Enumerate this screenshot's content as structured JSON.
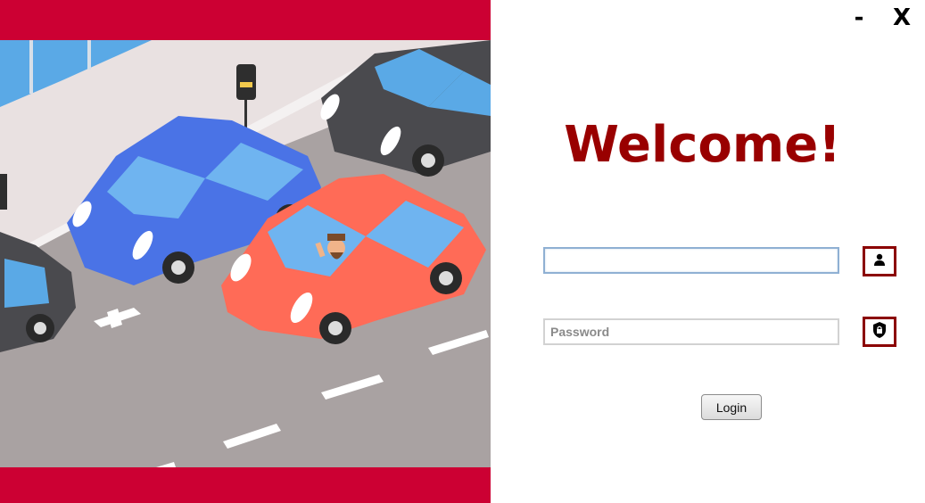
{
  "window": {
    "minimize_label": "-",
    "close_label": "X"
  },
  "login": {
    "heading": "Welcome!",
    "username": {
      "value": "",
      "placeholder": ""
    },
    "password": {
      "value": "",
      "placeholder": "Password"
    },
    "login_button_label": "Login",
    "user_icon": "person-icon",
    "lock_icon": "shield-lock-icon"
  },
  "colors": {
    "brand_red": "#cc0033",
    "heading_dark_red": "#990000",
    "icon_border": "#8b0000",
    "blue_car": "#4a73e6",
    "red_car": "#ff6b57",
    "dark_car": "#4a4a4e",
    "road": "#a9a2a2"
  }
}
